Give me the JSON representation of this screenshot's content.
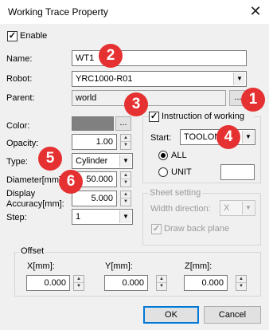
{
  "window": {
    "title": "Working Trace Property",
    "close_glyph": "✕"
  },
  "enable": {
    "label": "Enable",
    "checked": true
  },
  "name": {
    "label": "Name:",
    "value": "WT1"
  },
  "robot": {
    "label": "Robot:",
    "value": "YRC1000-R01"
  },
  "parent": {
    "label": "Parent:",
    "value": "world",
    "browse_label": "..."
  },
  "color": {
    "label": "Color:",
    "value": "#808080",
    "browse_label": "..."
  },
  "opacity": {
    "label": "Opacity:",
    "value": "1.00"
  },
  "type": {
    "label": "Type:",
    "value": "Cylinder"
  },
  "diameter": {
    "label": "Diameter[mm]",
    "value": "50.000"
  },
  "display_accuracy": {
    "label_line1": "Display",
    "label_line2": "Accuracy[mm]:",
    "value": "5.000"
  },
  "step": {
    "label": "Step:",
    "value": "1"
  },
  "instruction": {
    "label": "Instruction of working",
    "checked": true,
    "start_label": "Start:",
    "start_value": "TOOLON",
    "all_label": "ALL",
    "unit_label": "UNIT",
    "unit_value": ""
  },
  "sheet": {
    "label": "Sheet setting",
    "width_direction_label": "Width direction:",
    "width_direction_value": "X",
    "draw_back_plane_label": "Draw back plane"
  },
  "offset": {
    "label": "Offset",
    "x_label": "X[mm]:",
    "x_value": "0.000",
    "y_label": "Y[mm]:",
    "y_value": "0.000",
    "z_label": "Z[mm]:",
    "z_value": "0.000"
  },
  "buttons": {
    "ok": "OK",
    "cancel": "Cancel"
  },
  "badges": [
    "1",
    "2",
    "3",
    "4",
    "5",
    "6"
  ],
  "colors": {
    "badge": "#e53131",
    "dialog_bg": "#f0f0f0",
    "accent": "#0078d7"
  }
}
